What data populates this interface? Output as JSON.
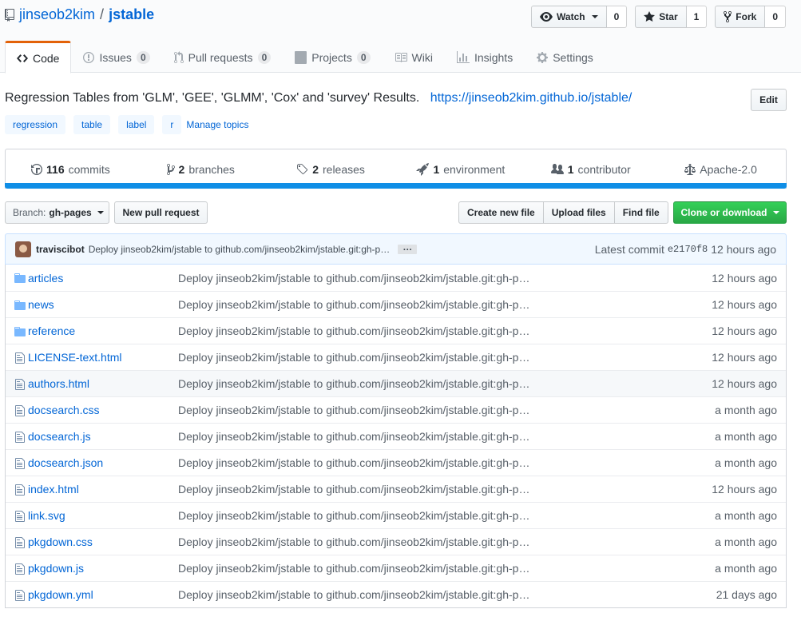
{
  "repo": {
    "owner": "jinseob2kim",
    "separator": "/",
    "name": "jstable"
  },
  "actions": {
    "watch_label": "Watch",
    "watch_count": "0",
    "star_label": "Star",
    "star_count": "1",
    "fork_label": "Fork",
    "fork_count": "0"
  },
  "nav": {
    "code": "Code",
    "issues": "Issues",
    "issues_count": "0",
    "pulls": "Pull requests",
    "pulls_count": "0",
    "projects": "Projects",
    "projects_count": "0",
    "wiki": "Wiki",
    "insights": "Insights",
    "settings": "Settings"
  },
  "description": {
    "text": "Regression Tables from 'GLM', 'GEE', 'GLMM', 'Cox' and 'survey' Results.",
    "url": "https://jinseob2kim.github.io/jstable/",
    "edit_label": "Edit"
  },
  "topics": [
    "regression",
    "table",
    "label",
    "r"
  ],
  "manage_topics": "Manage topics",
  "summary": {
    "commits_n": "116",
    "commits_label": "commits",
    "branches_n": "2",
    "branches_label": "branches",
    "releases_n": "2",
    "releases_label": "releases",
    "env_n": "1",
    "env_label": "environment",
    "contrib_n": "1",
    "contrib_label": "contributor",
    "license": "Apache-2.0"
  },
  "language_bar_color": "#0f8ee6",
  "toolbar": {
    "branch_prefix": "Branch:",
    "branch_name": "gh-pages",
    "new_pr": "New pull request",
    "create_file": "Create new file",
    "upload": "Upload files",
    "find": "Find file",
    "clone": "Clone or download"
  },
  "commit": {
    "author": "traviscibot",
    "message": "Deploy jinseob2kim/jstable to github.com/jinseob2kim/jstable.git:gh-p…",
    "ellipsis": "…",
    "latest_label": "Latest commit",
    "sha": "e2170f8",
    "age": "12 hours ago"
  },
  "files": [
    {
      "type": "dir",
      "name": "articles",
      "message": "Deploy jinseob2kim/jstable to github.com/jinseob2kim/jstable.git:gh-p…",
      "age": "12 hours ago"
    },
    {
      "type": "dir",
      "name": "news",
      "message": "Deploy jinseob2kim/jstable to github.com/jinseob2kim/jstable.git:gh-p…",
      "age": "12 hours ago"
    },
    {
      "type": "dir",
      "name": "reference",
      "message": "Deploy jinseob2kim/jstable to github.com/jinseob2kim/jstable.git:gh-p…",
      "age": "12 hours ago"
    },
    {
      "type": "file",
      "name": "LICENSE-text.html",
      "message": "Deploy jinseob2kim/jstable to github.com/jinseob2kim/jstable.git:gh-p…",
      "age": "12 hours ago"
    },
    {
      "type": "file",
      "name": "authors.html",
      "message": "Deploy jinseob2kim/jstable to github.com/jinseob2kim/jstable.git:gh-p…",
      "age": "12 hours ago"
    },
    {
      "type": "file",
      "name": "docsearch.css",
      "message": "Deploy jinseob2kim/jstable to github.com/jinseob2kim/jstable.git:gh-p…",
      "age": "a month ago"
    },
    {
      "type": "file",
      "name": "docsearch.js",
      "message": "Deploy jinseob2kim/jstable to github.com/jinseob2kim/jstable.git:gh-p…",
      "age": "a month ago"
    },
    {
      "type": "file",
      "name": "docsearch.json",
      "message": "Deploy jinseob2kim/jstable to github.com/jinseob2kim/jstable.git:gh-p…",
      "age": "a month ago"
    },
    {
      "type": "file",
      "name": "index.html",
      "message": "Deploy jinseob2kim/jstable to github.com/jinseob2kim/jstable.git:gh-p…",
      "age": "12 hours ago"
    },
    {
      "type": "file",
      "name": "link.svg",
      "message": "Deploy jinseob2kim/jstable to github.com/jinseob2kim/jstable.git:gh-p…",
      "age": "a month ago"
    },
    {
      "type": "file",
      "name": "pkgdown.css",
      "message": "Deploy jinseob2kim/jstable to github.com/jinseob2kim/jstable.git:gh-p…",
      "age": "a month ago"
    },
    {
      "type": "file",
      "name": "pkgdown.js",
      "message": "Deploy jinseob2kim/jstable to github.com/jinseob2kim/jstable.git:gh-p…",
      "age": "a month ago"
    },
    {
      "type": "file",
      "name": "pkgdown.yml",
      "message": "Deploy jinseob2kim/jstable to github.com/jinseob2kim/jstable.git:gh-p…",
      "age": "21 days ago"
    }
  ]
}
